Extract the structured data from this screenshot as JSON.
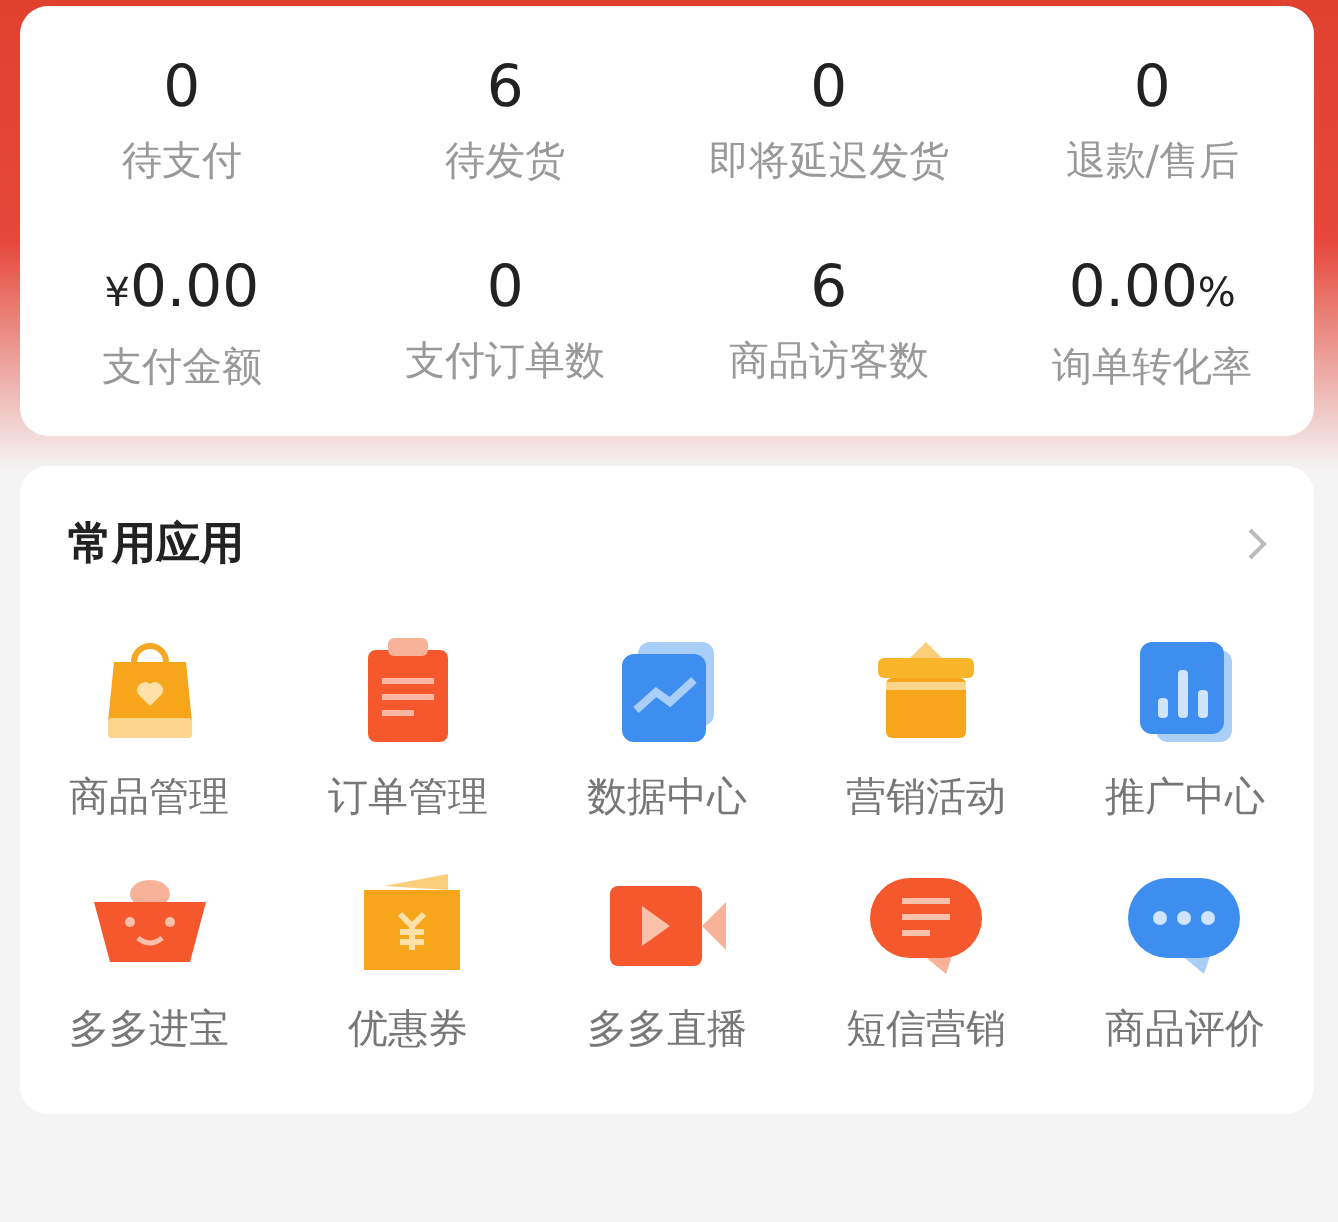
{
  "stats": [
    {
      "value": "0",
      "label": "待支付"
    },
    {
      "value": "6",
      "label": "待发货"
    },
    {
      "value": "0",
      "label": "即将延迟发货"
    },
    {
      "value": "0",
      "label": "退款/售后"
    },
    {
      "prefix": "¥",
      "value": "0.00",
      "label": "支付金额"
    },
    {
      "value": "0",
      "label": "支付订单数"
    },
    {
      "value": "6",
      "label": "商品访客数"
    },
    {
      "value": "0.00",
      "suffix": "%",
      "label": "询单转化率"
    }
  ],
  "apps": {
    "title": "常用应用",
    "items": [
      {
        "label": "商品管理"
      },
      {
        "label": "订单管理"
      },
      {
        "label": "数据中心"
      },
      {
        "label": "营销活动"
      },
      {
        "label": "推广中心"
      },
      {
        "label": "多多进宝"
      },
      {
        "label": "优惠券"
      },
      {
        "label": "多多直播"
      },
      {
        "label": "短信营销"
      },
      {
        "label": "商品评价"
      }
    ]
  }
}
